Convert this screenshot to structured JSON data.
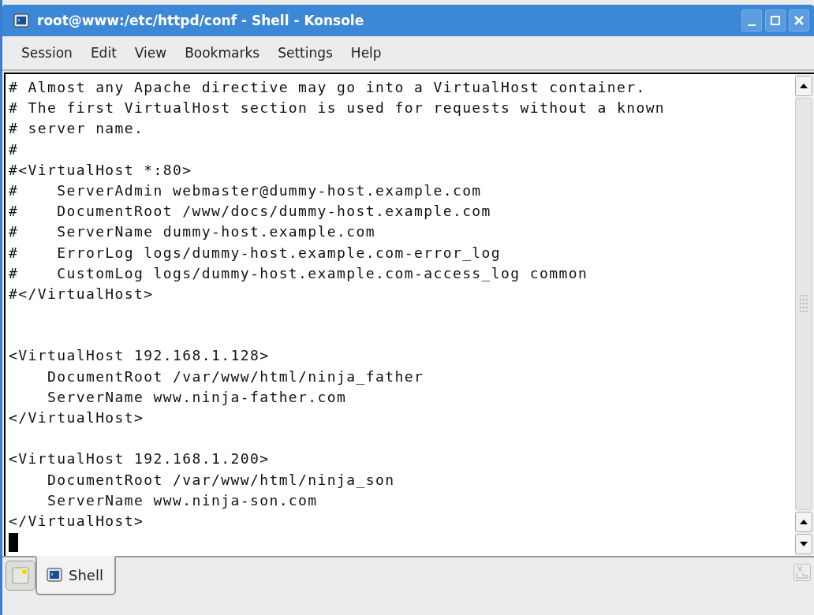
{
  "window": {
    "title": "root@www:/etc/httpd/conf - Shell - Konsole"
  },
  "menu": [
    "Session",
    "Edit",
    "View",
    "Bookmarks",
    "Settings",
    "Help"
  ],
  "terminal": {
    "lines": [
      {
        "kind": "text",
        "text": "# Almost any Apache directive may go into a VirtualHost container."
      },
      {
        "kind": "text",
        "text": "# The first VirtualHost section is used for requests without a known"
      },
      {
        "kind": "text",
        "text": "# server name."
      },
      {
        "kind": "text",
        "text": "#"
      },
      {
        "kind": "text",
        "text": "#<VirtualHost *:80>"
      },
      {
        "kind": "text",
        "text": "#    ServerAdmin webmaster@dummy-host.example.com"
      },
      {
        "kind": "text",
        "text": "#    DocumentRoot /www/docs/dummy-host.example.com"
      },
      {
        "kind": "text",
        "text": "#    ServerName dummy-host.example.com"
      },
      {
        "kind": "text",
        "text": "#    ErrorLog logs/dummy-host.example.com-error_log"
      },
      {
        "kind": "text",
        "text": "#    CustomLog logs/dummy-host.example.com-access_log common"
      },
      {
        "kind": "text",
        "text": "#</VirtualHost>"
      },
      {
        "kind": "blank"
      },
      {
        "kind": "blank"
      },
      {
        "kind": "text",
        "text": "<VirtualHost 192.168.1.128>"
      },
      {
        "kind": "text",
        "text": "    DocumentRoot /var/www/html/ninja_father"
      },
      {
        "kind": "text",
        "text": "    ServerName www.ninja-father.com"
      },
      {
        "kind": "text",
        "text": "</VirtualHost>"
      },
      {
        "kind": "blank"
      },
      {
        "kind": "text",
        "text": "<VirtualHost 192.168.1.200>"
      },
      {
        "kind": "text",
        "text": "    DocumentRoot /var/www/html/ninja_son"
      },
      {
        "kind": "text",
        "text": "    ServerName www.ninja-son.com"
      },
      {
        "kind": "text",
        "text": "</VirtualHost>"
      },
      {
        "kind": "cursor"
      }
    ]
  },
  "tabs": [
    {
      "label": "Shell",
      "selected": true
    }
  ]
}
